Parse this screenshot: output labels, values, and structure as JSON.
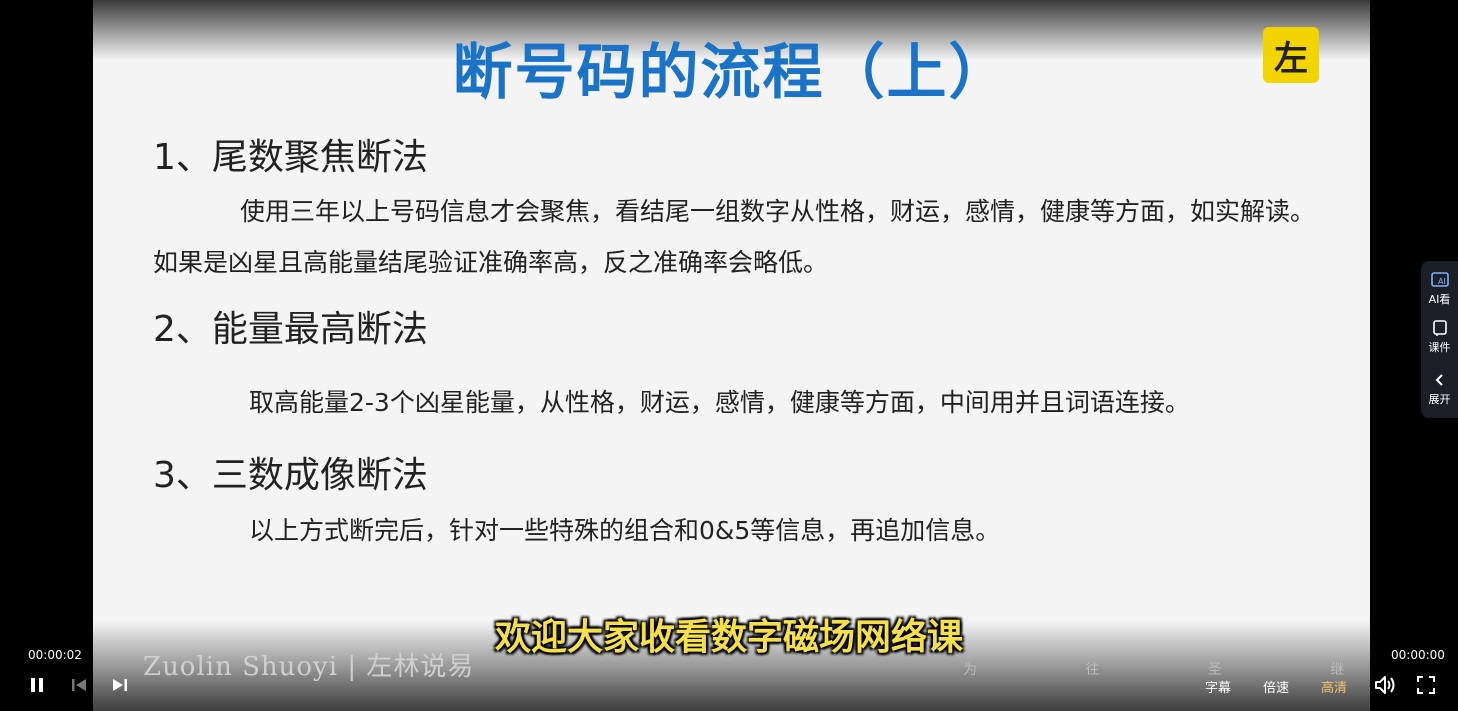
{
  "slide": {
    "title": "断号码的流程（上）",
    "logo_char": "左",
    "sections": [
      {
        "heading": "1、尾数聚焦断法",
        "lines": [
          "使用三年以上号码信息才会聚焦，看结尾一组数字从性格，财运，感情，健康等方面，如实解读。",
          "如果是凶星且高能量结尾验证准确率高，反之准确率会略低。"
        ]
      },
      {
        "heading": "2、能量最高断法",
        "lines": [
          "取高能量2-3个凶星能量，从性格，财运，感情，健康等方面，中间用并且词语连接。"
        ]
      },
      {
        "heading": "3、三数成像断法",
        "lines": [
          "以上方式断完后，针对一些特殊的组合和0&5等信息，再追加信息。"
        ]
      }
    ],
    "brand": "Zuolin Shuoyi | 左林说易",
    "motto": "为 往 圣 继 绝 学 !"
  },
  "subtitle": "欢迎大家收看数字磁场网络课",
  "player": {
    "time_left": "00:00:02",
    "time_right": "00:00:00",
    "buttons": {
      "subtitles": "字幕",
      "speed": "倍速",
      "quality": "高清"
    }
  },
  "sidebar": [
    {
      "label": "AI看",
      "icon": "ai-watch-icon"
    },
    {
      "label": "课件",
      "icon": "courseware-icon"
    },
    {
      "label": "展开",
      "icon": "chevron-left-icon"
    }
  ],
  "colors": {
    "title": "#1a73c7",
    "subtitle": "#f5e04a",
    "logo_bg": "#f2d400",
    "quality_accent": "#f0c46a"
  }
}
